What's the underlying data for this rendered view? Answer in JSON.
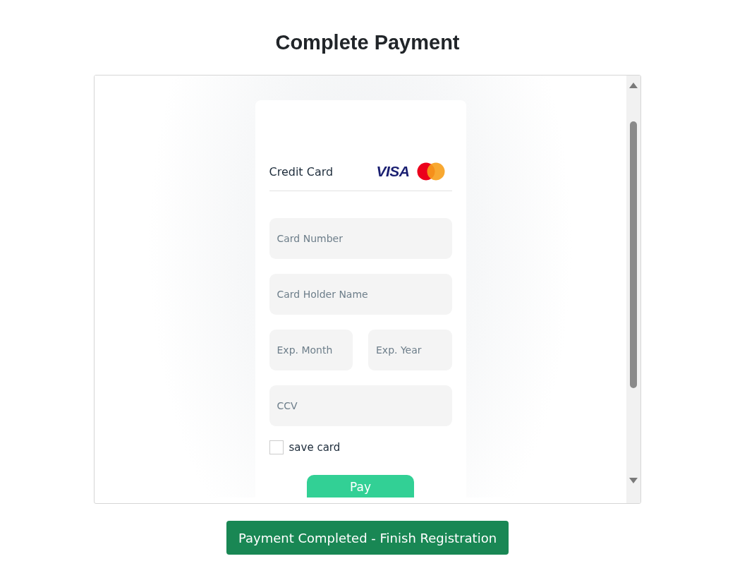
{
  "title": "Complete Payment",
  "payment_form": {
    "heading": "Credit Card",
    "visa_logo": "VISA",
    "fields": [
      {
        "placeholder": "Card Number",
        "kind": "wide"
      },
      {
        "placeholder": "Card Holder Name",
        "kind": "wide"
      },
      {
        "placeholder": "Exp. Month",
        "kind": "narrow"
      },
      {
        "placeholder": "Exp. Year",
        "kind": "narrow"
      },
      {
        "placeholder": "CCV",
        "kind": "wide"
      }
    ],
    "save_card": {
      "label": "save card",
      "checked": false
    },
    "pay_button": "Pay"
  },
  "finish_button": "Payment Completed - Finish Registration"
}
